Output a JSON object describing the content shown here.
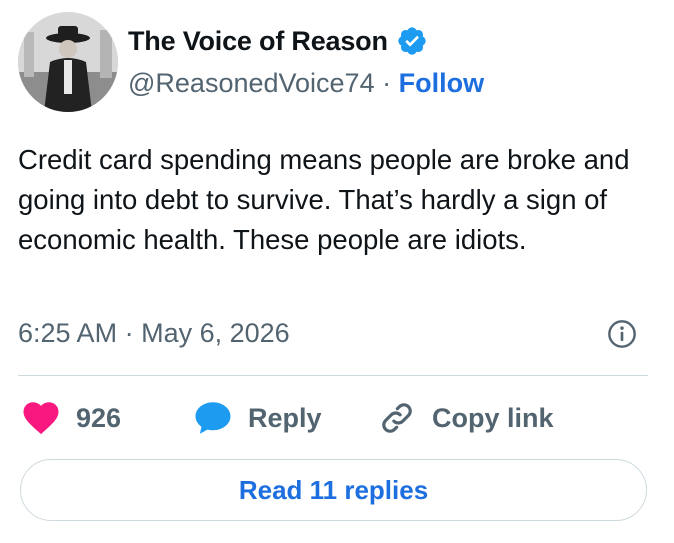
{
  "author": {
    "display_name": "The Voice of Reason",
    "handle": "@ReasonedVoice74",
    "separator": "·",
    "follow_label": "Follow",
    "verified": true
  },
  "tweet": {
    "text": "Credit card spending means people are broke and going into debt to survive. That’s hardly a sign of economic health. These people are idiots.",
    "time": "6:25 AM",
    "separator": "·",
    "date": "May 6, 2026"
  },
  "actions": {
    "like_count": "926",
    "reply_label": "Reply",
    "copy_link_label": "Copy link"
  },
  "read_replies_label": "Read 11 replies",
  "icons": {
    "verified": "verified-badge-icon",
    "info": "info-icon",
    "like": "heart-icon",
    "reply": "speech-bubble-icon",
    "copy_link": "link-icon"
  },
  "colors": {
    "link_blue": "#1d6fe0",
    "verified_blue": "#1d9bf0",
    "heart_pink": "#f91880",
    "secondary_text": "#536471",
    "divider": "#cfd9de"
  }
}
